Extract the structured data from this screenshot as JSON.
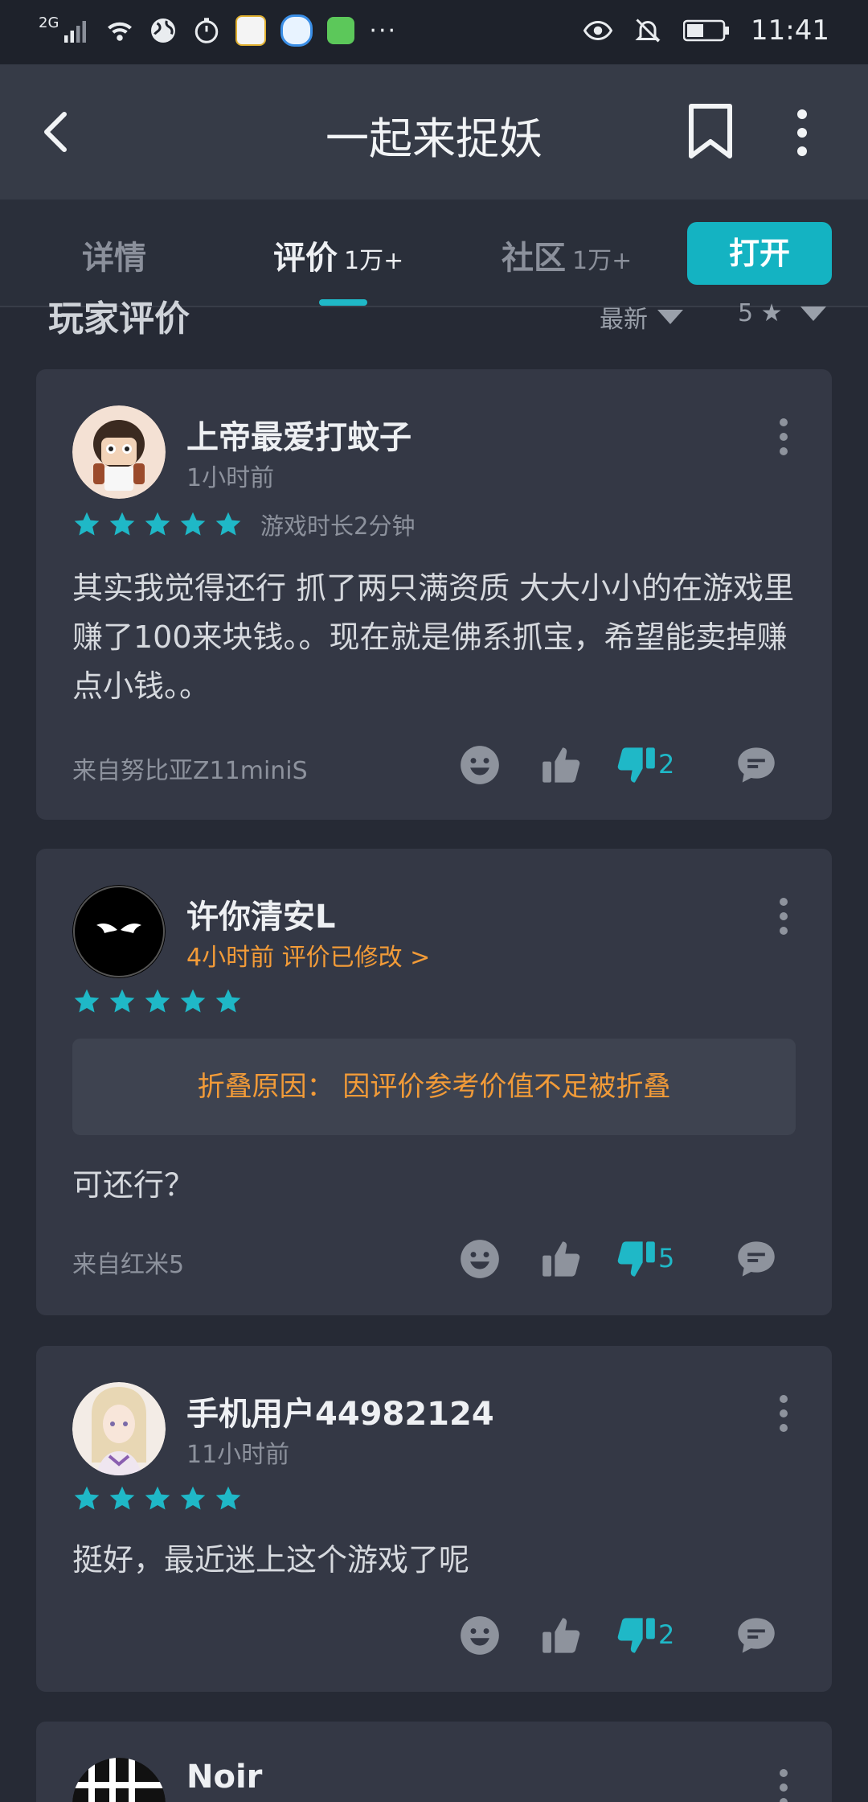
{
  "status_bar": {
    "network": "2G",
    "time": "11:41"
  },
  "header": {
    "title": "一起来捉妖"
  },
  "tabs": [
    {
      "label": "详情",
      "count": ""
    },
    {
      "label": "评价",
      "count": "1万+"
    },
    {
      "label": "社区",
      "count": "1万+"
    }
  ],
  "open_button": "打开",
  "section": {
    "title": "玩家评价",
    "sort": "最新",
    "filter": "5 ★"
  },
  "reviews": [
    {
      "user": "上帝最爱打蚊子",
      "time": "1小时前",
      "stars": 5,
      "playtime": "游戏时长2分钟",
      "text": "其实我觉得还行 抓了两只满资质 大大小小的在游戏里赚了100来块钱。。现在就是佛系抓宝，希望能卖掉赚点小钱。。",
      "device": "来自努比亚Z11miniS",
      "dislikes": "2"
    },
    {
      "user": "许你清安L",
      "time": "4小时前 评价已修改 >",
      "stars": 5,
      "fold_reason": "折叠原因：  因评价参考价值不足被折叠",
      "text": "可还行？",
      "device": "来自红米5",
      "dislikes": "5"
    },
    {
      "user": "手机用户44982124",
      "time": "11小时前",
      "stars": 5,
      "text": "挺好，最近迷上这个游戏了呢",
      "device": "",
      "dislikes": "2"
    },
    {
      "user": "Noir"
    }
  ],
  "colors": {
    "accent": "#14b3c2",
    "background": "#262a35",
    "card": "#343845",
    "warning": "#f29b38"
  }
}
